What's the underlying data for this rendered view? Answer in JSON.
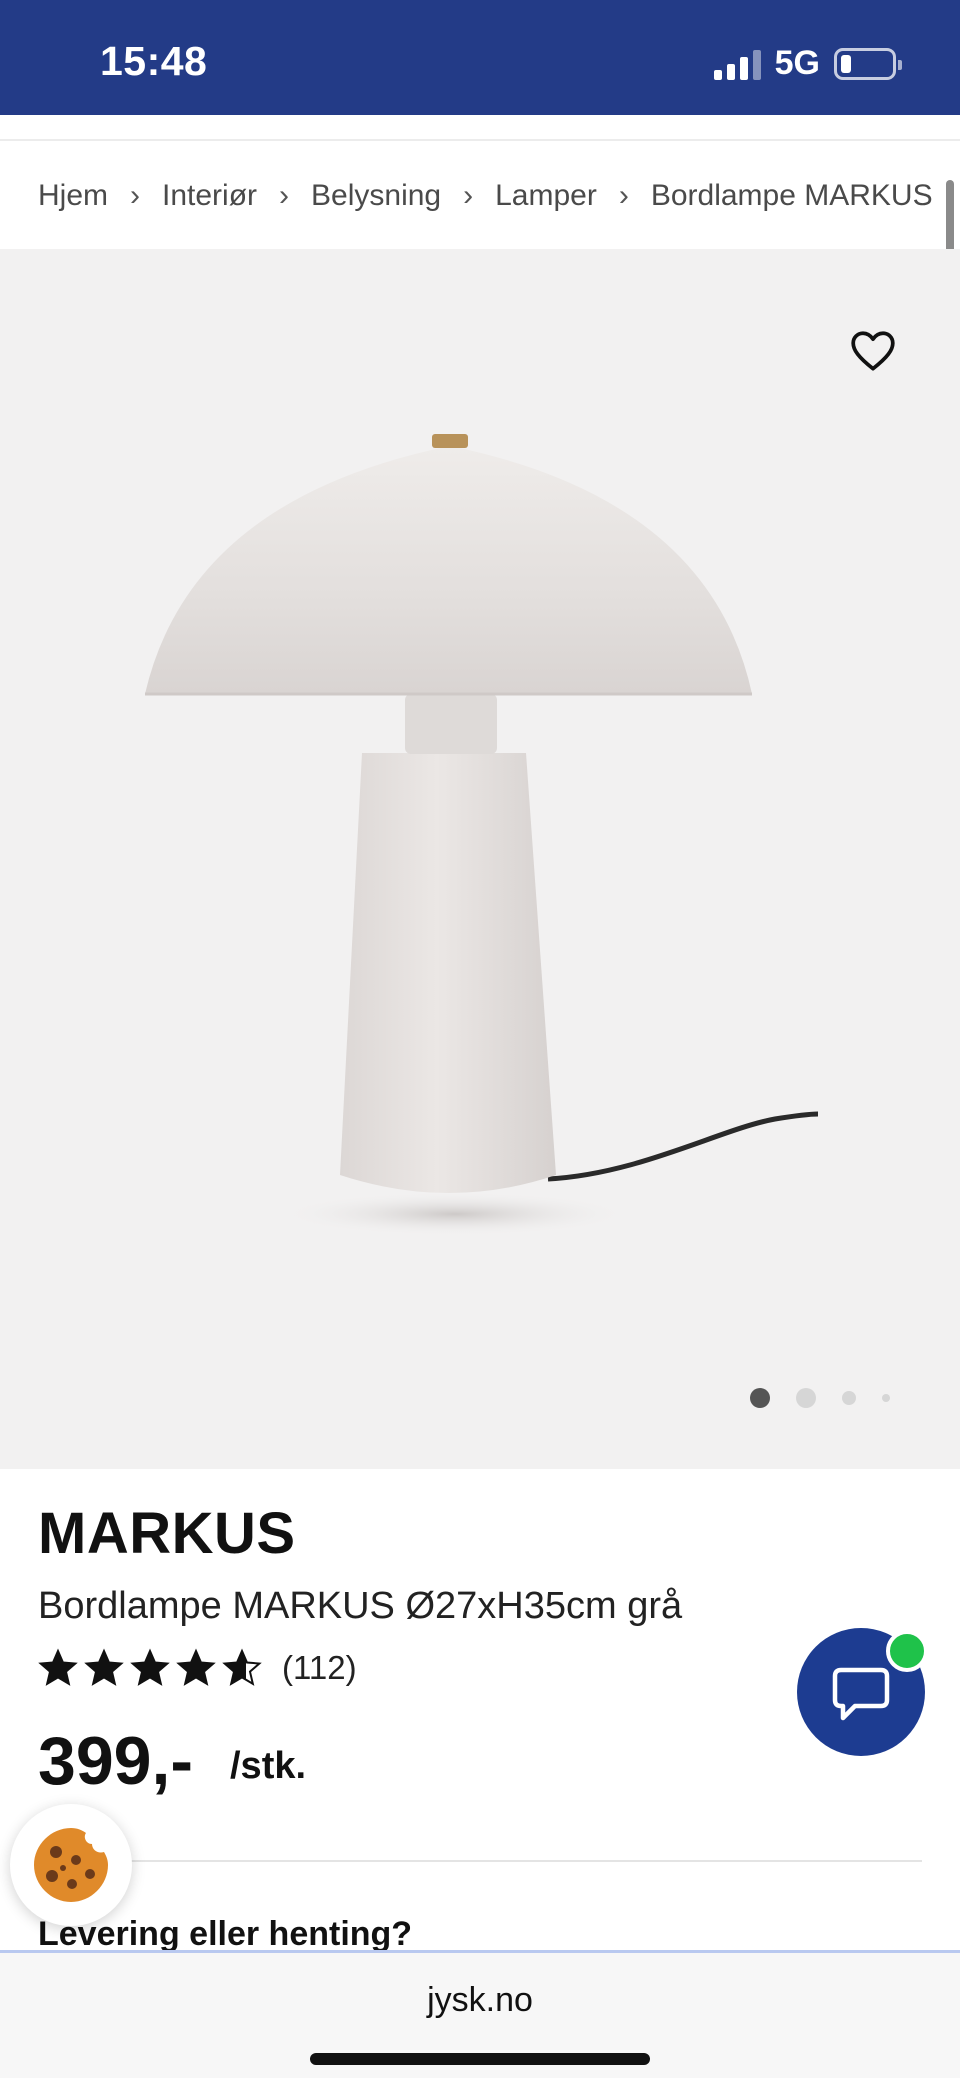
{
  "status_bar": {
    "time": "15:48",
    "network": "5G",
    "battery_level": 0.2
  },
  "breadcrumb": [
    {
      "label": "Hjem"
    },
    {
      "label": "Interiør"
    },
    {
      "label": "Belysning"
    },
    {
      "label": "Lamper"
    },
    {
      "label": "Bordlampe MARKUS"
    }
  ],
  "gallery": {
    "image_count": 4,
    "active_index": 0,
    "favorite_icon": "heart-outline-icon"
  },
  "product": {
    "brand": "MARKUS",
    "name": "Bordlampe MARKUS Ø27xH35cm grå",
    "rating": 4.6,
    "rating_max": 5,
    "review_count": "(112)",
    "price": "399,-",
    "unit": "/stk."
  },
  "delivery": {
    "heading": "Levering eller henting?"
  },
  "chat": {
    "icon": "chat-bubble-icon",
    "status_color": "#1fc24a"
  },
  "cookie": {
    "icon": "cookie-icon"
  },
  "browser": {
    "url": "jysk.no"
  },
  "colors": {
    "brand_blue": "#233b87",
    "chat_blue": "#1d3c91",
    "online_green": "#1fc24a"
  }
}
